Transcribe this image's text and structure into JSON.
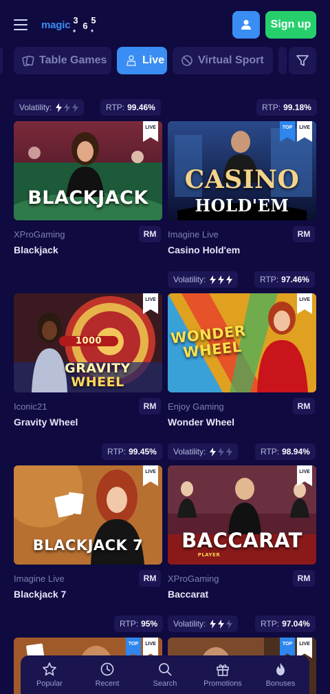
{
  "header": {
    "logo_word": "magic",
    "logo_digits": [
      "3",
      "6",
      "5"
    ],
    "signup_label": "Sign up"
  },
  "tabs": [
    {
      "label": "Table Games",
      "icon": "cards-icon",
      "active": false
    },
    {
      "label": "Live",
      "icon": "dealer-icon",
      "active": true
    },
    {
      "label": "Virtual Sport",
      "icon": "ball-icon",
      "active": false
    }
  ],
  "labels": {
    "volatility": "Volatility:",
    "rtp": "RTP:"
  },
  "games": [
    {
      "provider": "XProGaming",
      "name": "Blackjack",
      "art_title": "BLACKJACK",
      "badge": "RM",
      "live": "LIVE",
      "top": null,
      "rtp": "99.46%",
      "volatility_level": 1
    },
    {
      "provider": "Imagine Live",
      "name": "Casino Hold'em",
      "art_title": "CASINO",
      "art_subtitle": "HOLD'EM",
      "badge": "RM",
      "live": "LIVE",
      "top": "TOP",
      "rtp": "99.18%",
      "volatility_level": null
    },
    {
      "provider": "Iconic21",
      "name": "Gravity Wheel",
      "art_title": "GRAVITY",
      "art_subtitle": "WHEEL",
      "art_number": "1000",
      "badge": "RM",
      "live": "LIVE",
      "top": null,
      "rtp": null,
      "volatility_level": null
    },
    {
      "provider": "Enjoy Gaming",
      "name": "Wonder Wheel",
      "art_title": "WONDER",
      "art_subtitle": "WHEEL",
      "badge": "RM",
      "live": "LIVE",
      "top": null,
      "rtp": "97.46%",
      "volatility_level": 3
    },
    {
      "provider": "Imagine Live",
      "name": "Blackjack 7",
      "art_title": "BLACKJACK 7",
      "badge": "RM",
      "live": "LIVE",
      "top": null,
      "rtp": "99.45%",
      "volatility_level": null
    },
    {
      "provider": "XProGaming",
      "name": "Baccarat",
      "art_title": "BACCARAT",
      "art_small": "PLAYER",
      "badge": "RM",
      "live": "LIVE",
      "top": null,
      "rtp": "98.94%",
      "volatility_level": 1
    },
    {
      "provider": "",
      "name": "",
      "badge": "",
      "live": "LIVE",
      "top": "TOP",
      "rtp": "95%",
      "volatility_level": null
    },
    {
      "provider": "",
      "name": "",
      "badge": "",
      "live": "LIVE",
      "top": "TOP",
      "rtp": "97.04%",
      "volatility_level": 2
    }
  ],
  "bottom_nav": [
    {
      "label": "Popular",
      "icon": "star-icon"
    },
    {
      "label": "Recent",
      "icon": "clock-icon"
    },
    {
      "label": "Search",
      "icon": "search-icon"
    },
    {
      "label": "Promotions",
      "icon": "gift-icon"
    },
    {
      "label": "Bonuses",
      "icon": "flame-icon"
    }
  ],
  "colors": {
    "background": "#0f0a40",
    "surface": "#1c1655",
    "accent": "#3a8df3",
    "signup": "#27cf6c"
  }
}
